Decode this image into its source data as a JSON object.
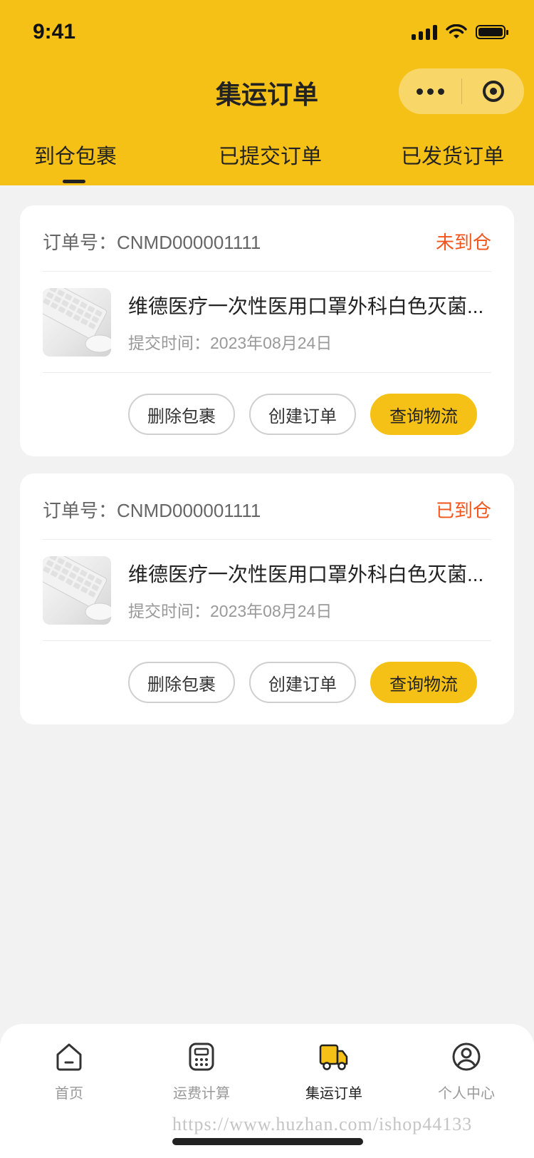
{
  "status_bar": {
    "time": "9:41"
  },
  "nav": {
    "title": "集运订单"
  },
  "tabs": [
    {
      "label": "到仓包裹",
      "active": true
    },
    {
      "label": "已提交订单",
      "active": false
    },
    {
      "label": "已发货订单",
      "active": false
    }
  ],
  "orders": [
    {
      "order_no_label": "订单号：CNMD000001111",
      "status": "未到仓",
      "product_title": "维德医疗一次性医用口罩外科白色灭菌...",
      "submit_time": "提交时间：2023年08月24日",
      "actions": {
        "delete": "删除包裹",
        "create": "创建订单",
        "track": "查询物流"
      }
    },
    {
      "order_no_label": "订单号：CNMD000001111",
      "status": "已到仓",
      "product_title": "维德医疗一次性医用口罩外科白色灭菌...",
      "submit_time": "提交时间：2023年08月24日",
      "actions": {
        "delete": "删除包裹",
        "create": "创建订单",
        "track": "查询物流"
      }
    }
  ],
  "tabbar": [
    {
      "label": "首页",
      "icon": "home-icon",
      "active": false
    },
    {
      "label": "运费计算",
      "icon": "calculator-icon",
      "active": false
    },
    {
      "label": "集运订单",
      "icon": "truck-icon",
      "active": true
    },
    {
      "label": "个人中心",
      "icon": "user-icon",
      "active": false
    }
  ],
  "watermark": "https://www.huzhan.com/ishop44133",
  "colors": {
    "brand": "#f5c116",
    "status": "#f3541c",
    "background": "#f2f2f2"
  }
}
